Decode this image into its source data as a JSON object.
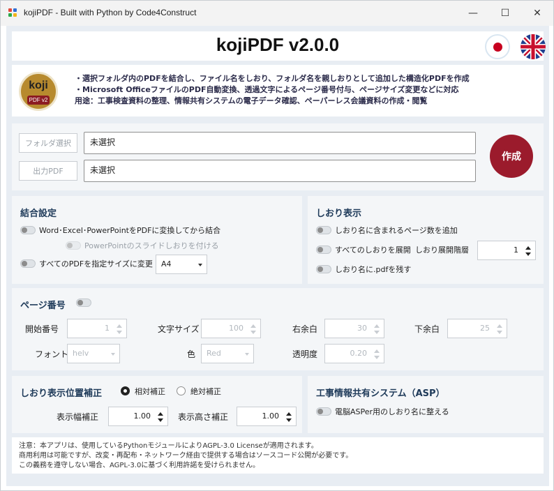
{
  "window": {
    "title": "kojiPDF - Built with Python by Code4Construct",
    "minimize": "—",
    "maximize": "☐",
    "close": "✕"
  },
  "header": {
    "app_title": "kojiPDF v2.0.0"
  },
  "info": {
    "logo_text": "koji",
    "logo_tag": "PDF v2",
    "lines": [
      "・選択フォルダ内のPDFを結合し、ファイル名をしおり、フォルダ名を親しおりとして追加した構造化PDFを作成",
      "・Microsoft OfficeファイルのPDF自動変換、透過文字によるページ番号付与、ページサイズ変更などに対応",
      "用途：工事検査資料の整理、情報共有システムの電子データ確認、ペーパーレス会議資料の作成・閲覧"
    ]
  },
  "io": {
    "folder_button": "フォルダ選択",
    "folder_value": "未選択",
    "output_button": "出力PDF",
    "output_value": "未選択",
    "create_button": "作成"
  },
  "merge": {
    "title": "結合設定",
    "convert_label": "Word･Excel･PowerPointをPDFに変換してから結合",
    "slide_bookmark_label": "PowerPointのスライドしおりを付ける",
    "resize_label": "すべてのPDFを指定サイズに変更",
    "size_value": "A4"
  },
  "bookmark": {
    "title": "しおり表示",
    "page_count_label": "しおり名に含まれるページ数を追加",
    "expand_label": "すべてのしおりを展開",
    "expand_level_label": "しおり展開階層",
    "expand_level_value": "1",
    "keep_ext_label": "しおり名に.pdfを残す"
  },
  "page_number": {
    "title": "ページ番号",
    "start_label": "開始番号",
    "start_value": "1",
    "font_size_label": "文字サイズ",
    "font_size_value": "100",
    "right_margin_label": "右余白",
    "right_margin_value": "30",
    "bottom_margin_label": "下余白",
    "bottom_margin_value": "25",
    "font_label": "フォント",
    "font_value": "helv",
    "color_label": "色",
    "color_value": "Red",
    "opacity_label": "透明度",
    "opacity_value": "0.20"
  },
  "position": {
    "title": "しおり表示位置補正",
    "relative_label": "相対補正",
    "absolute_label": "絶対補正",
    "width_label": "表示幅補正",
    "width_value": "1.00",
    "height_label": "表示高さ補正",
    "height_value": "1.00"
  },
  "asp": {
    "title": "工事情報共有システム（ASP）",
    "denno_label": "電脳ASPer用のしおり名に整える"
  },
  "notice": {
    "lines": [
      "注意：本アプリは、使用しているPythonモジュールによりAGPL-3.0 Licenseが適用されます。",
      "商用利用は可能ですが、改変・再配布・ネットワーク経由で提供する場合はソースコード公開が必要です。",
      "この義務を遵守しない場合、AGPL-3.0に基づく利用許諾を受けられません。"
    ]
  },
  "colors": {
    "accent": "#9b1b2c",
    "section_title": "#1f3b5a",
    "background": "#e8edf3"
  }
}
